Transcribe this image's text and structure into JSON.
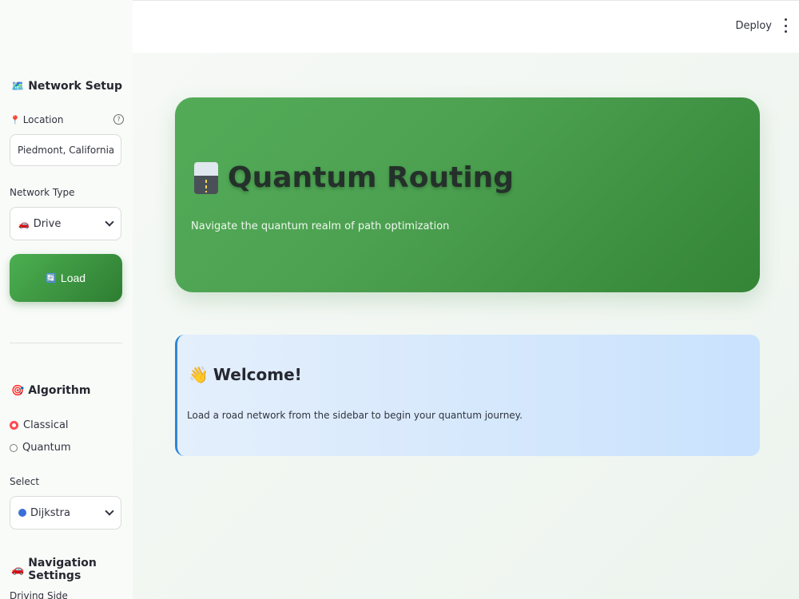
{
  "topbar": {
    "deploy_label": "Deploy"
  },
  "sidebar": {
    "network_setup": {
      "emoji": "🗺️",
      "title": "Network Setup"
    },
    "location": {
      "emoji": "📍",
      "label": "Location",
      "help": "?",
      "value": "Piedmont, California, USA"
    },
    "network_type": {
      "label": "Network Type",
      "emoji": "🚗",
      "selected": "Drive"
    },
    "load_button": {
      "icon": "🔄",
      "label": "Load"
    },
    "algorithm": {
      "emoji": "🎯",
      "title": "Algorithm",
      "options": [
        {
          "label": "Classical",
          "selected": true
        },
        {
          "label": "Quantum",
          "selected": false
        }
      ]
    },
    "select": {
      "label": "Select",
      "selected": "Dijkstra"
    },
    "navigation_settings": {
      "emoji": "🚗",
      "title": "Navigation Settings"
    },
    "driving_side_label": "Driving Side"
  },
  "hero": {
    "title": "Quantum Routing",
    "subtitle": "Navigate the quantum realm of path optimization"
  },
  "welcome": {
    "emoji": "👋",
    "title": "Welcome!",
    "text": "Load a road network from the sidebar to begin your quantum journey."
  },
  "colors": {
    "accent_green": "#4caf50",
    "accent_green_dark": "#2e7d32",
    "radio_selected": "#ff4b4b",
    "info_border": "#2d86d8"
  }
}
